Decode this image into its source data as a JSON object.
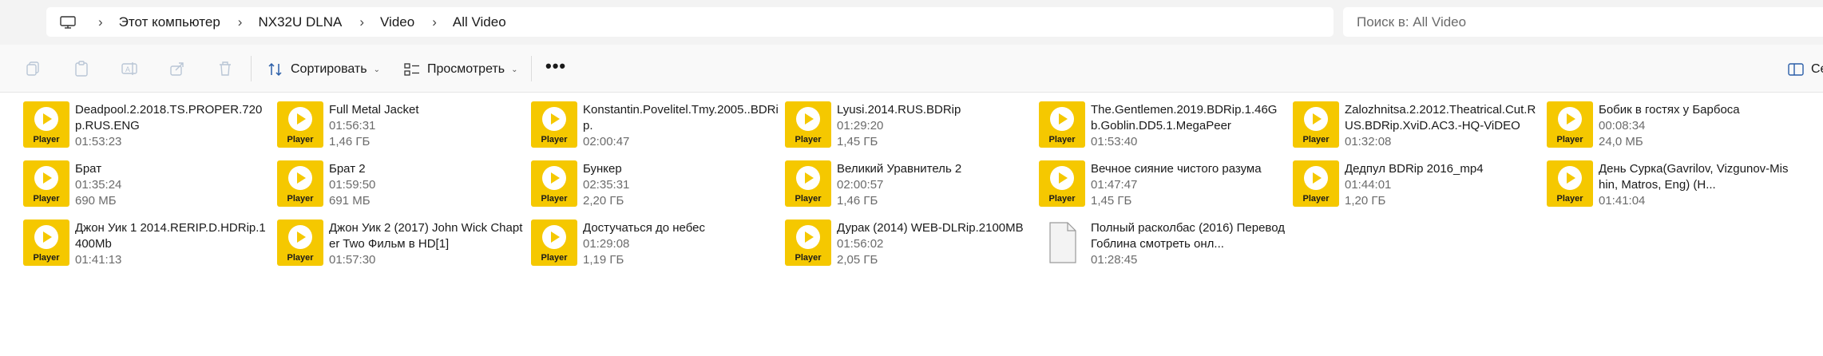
{
  "address": {
    "crumbs": [
      "Этот компьютер",
      "NX32U DLNA",
      "Video",
      "All Video"
    ]
  },
  "search": {
    "placeholder": "Поиск в: All Video"
  },
  "toolbar": {
    "sort_label": "Сортировать",
    "view_label": "Просмотреть",
    "more_label": "•••",
    "right_label": "Се"
  },
  "thumb_label": "Player",
  "items": [
    {
      "name": "Deadpool.2.2018.TS.PROPER.720p.RUS.ENG",
      "lines": [
        "01:53:23"
      ],
      "type": "video"
    },
    {
      "name": "Full Metal Jacket",
      "lines": [
        "01:56:31",
        "1,46 ГБ"
      ],
      "type": "video"
    },
    {
      "name": "Konstantin.Povelitel.Tmy.2005..BDRip.",
      "lines": [
        "02:00:47"
      ],
      "type": "video"
    },
    {
      "name": "Lyusi.2014.RUS.BDRip",
      "lines": [
        "01:29:20",
        "1,45 ГБ"
      ],
      "type": "video"
    },
    {
      "name": "The.Gentlemen.2019.BDRip.1.46Gb.Goblin.DD5.1.MegaPeer",
      "lines": [
        "01:53:40"
      ],
      "type": "video"
    },
    {
      "name": "Zalozhnitsa.2.2012.Theatrical.Cut.RUS.BDRip.XviD.AC3.-HQ-ViDEO",
      "lines": [
        "01:32:08"
      ],
      "type": "video"
    },
    {
      "name": "Бобик в гостях у Барбоса",
      "lines": [
        "00:08:34",
        "24,0 МБ"
      ],
      "type": "video"
    },
    {
      "name": "Брат",
      "lines": [
        "01:35:24",
        "690 МБ"
      ],
      "type": "video"
    },
    {
      "name": "Брат 2",
      "lines": [
        "01:59:50",
        "691 МБ"
      ],
      "type": "video"
    },
    {
      "name": "Бункер",
      "lines": [
        "02:35:31",
        "2,20 ГБ"
      ],
      "type": "video"
    },
    {
      "name": "Великий Уравнитель 2",
      "lines": [
        "02:00:57",
        "1,46 ГБ"
      ],
      "type": "video"
    },
    {
      "name": "Вечное сияние чистого разума",
      "lines": [
        "01:47:47",
        "1,45 ГБ"
      ],
      "type": "video"
    },
    {
      "name": "Дедпул BDRip 2016_mp4",
      "lines": [
        "01:44:01",
        "1,20 ГБ"
      ],
      "type": "video"
    },
    {
      "name": "День Сурка(Gavrilov, Vizgunov-Mishin, Matros, Eng) (H...",
      "lines": [
        "01:41:04"
      ],
      "type": "video"
    },
    {
      "name": "Джон Уик 1 2014.RERIP.D.HDRip.1400Mb",
      "lines": [
        "01:41:13"
      ],
      "type": "video"
    },
    {
      "name": "Джон Уик 2 (2017)  John Wick Chapter Two  Фильм в HD[1]",
      "lines": [
        "01:57:30"
      ],
      "type": "video"
    },
    {
      "name": "Достучаться до небес",
      "lines": [
        "01:29:08",
        "1,19 ГБ"
      ],
      "type": "video"
    },
    {
      "name": "Дурак (2014) WEB-DLRip.2100MB",
      "lines": [
        "01:56:02",
        "2,05 ГБ"
      ],
      "type": "video"
    },
    {
      "name": "Полный расколбас (2016) Перевод Гоблина смотреть онл...",
      "lines": [
        "01:28:45"
      ],
      "type": "document"
    }
  ]
}
